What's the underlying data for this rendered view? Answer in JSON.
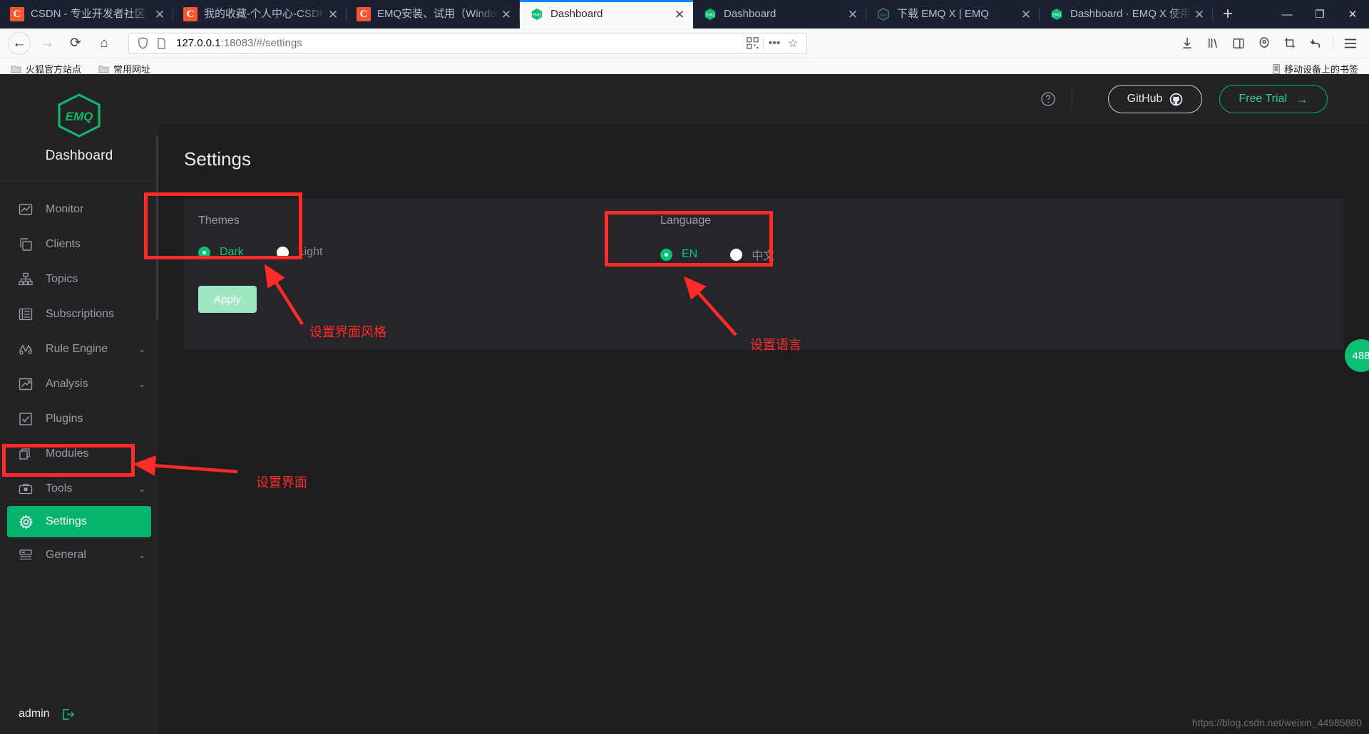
{
  "browser": {
    "tabs": [
      {
        "title": "CSDN - 专业开发者社区",
        "favicon": "csdn-icon",
        "active": false
      },
      {
        "title": "我的收藏-个人中心-CSDN",
        "favicon": "csdn-icon",
        "active": false
      },
      {
        "title": "EMQ安装、试用（Windows）",
        "favicon": "csdn-icon",
        "active": false
      },
      {
        "title": "Dashboard",
        "favicon": "emq-icon",
        "active": true
      },
      {
        "title": "Dashboard",
        "favicon": "emq-icon",
        "active": false
      },
      {
        "title": "下载 EMQ X | EMQ",
        "favicon": "emq-icon",
        "active": false
      },
      {
        "title": "Dashboard · EMQ X 使用",
        "favicon": "emq-icon",
        "active": false
      }
    ],
    "new_tab_label": "+",
    "tab_close_label": "✕",
    "window_controls": {
      "minimize": "—",
      "maximize": "❐",
      "close": "✕"
    },
    "nav": {
      "back": "←",
      "forward": "→",
      "reload": "⟳",
      "home": "⌂"
    },
    "url": {
      "protocol_host": "127.0.0.1",
      "rest": ":18083/#/settings"
    },
    "bookmarks": [
      {
        "label": "火狐官方站点",
        "icon": "folder-icon"
      },
      {
        "label": "常用网址",
        "icon": "folder-icon"
      }
    ],
    "bookmarks_right": {
      "label": "移动设备上的书签",
      "icon": "mobile-icon"
    }
  },
  "sidebar": {
    "brand": "Dashboard",
    "logo_text": "EMQ",
    "items": [
      {
        "label": "Monitor",
        "icon": "monitor-chart-icon",
        "expandable": false,
        "active": false
      },
      {
        "label": "Clients",
        "icon": "clients-icon",
        "expandable": false,
        "active": false
      },
      {
        "label": "Topics",
        "icon": "topics-tree-icon",
        "expandable": false,
        "active": false
      },
      {
        "label": "Subscriptions",
        "icon": "subscriptions-list-icon",
        "expandable": false,
        "active": false
      },
      {
        "label": "Rule Engine",
        "icon": "rule-engine-icon",
        "expandable": true,
        "active": false
      },
      {
        "label": "Analysis",
        "icon": "analysis-trend-icon",
        "expandable": true,
        "active": false
      },
      {
        "label": "Plugins",
        "icon": "plugins-check-icon",
        "expandable": false,
        "active": false
      },
      {
        "label": "Modules",
        "icon": "modules-stack-icon",
        "expandable": false,
        "active": false
      },
      {
        "label": "Tools",
        "icon": "tools-briefcase-icon",
        "expandable": true,
        "active": false
      },
      {
        "label": "Settings",
        "icon": "gear-icon",
        "expandable": false,
        "active": true
      },
      {
        "label": "General",
        "icon": "general-icon",
        "expandable": true,
        "active": false
      }
    ],
    "chevron": "⌄",
    "user": "admin",
    "logout_icon": "logout-icon"
  },
  "topbar": {
    "help_icon": "help-circle-icon",
    "github_label": "GitHub",
    "github_icon": "github-icon",
    "free_trial_label": "Free Trial",
    "free_trial_arrow": "→"
  },
  "main": {
    "page_title": "Settings",
    "themes": {
      "title": "Themes",
      "options": [
        {
          "label": "Dark",
          "selected": true
        },
        {
          "label": "Light",
          "selected": false
        }
      ]
    },
    "language": {
      "title": "Language",
      "options": [
        {
          "label": "EN",
          "selected": true
        },
        {
          "label": "中文",
          "selected": false
        }
      ]
    },
    "apply_label": "Apply"
  },
  "annotations": {
    "themes_note": "设置界面风格",
    "language_note": "设置语言",
    "settings_note": "设置界面",
    "color": "#ff2b28"
  },
  "misc": {
    "watermark": "https://blog.csdn.net/weixin_44985880",
    "fab_badge": "488"
  },
  "colors": {
    "accent_green": "#05b36c",
    "sidebar_bg": "#232326",
    "content_bg": "#1e1e21",
    "panel_bg": "#26262a"
  }
}
